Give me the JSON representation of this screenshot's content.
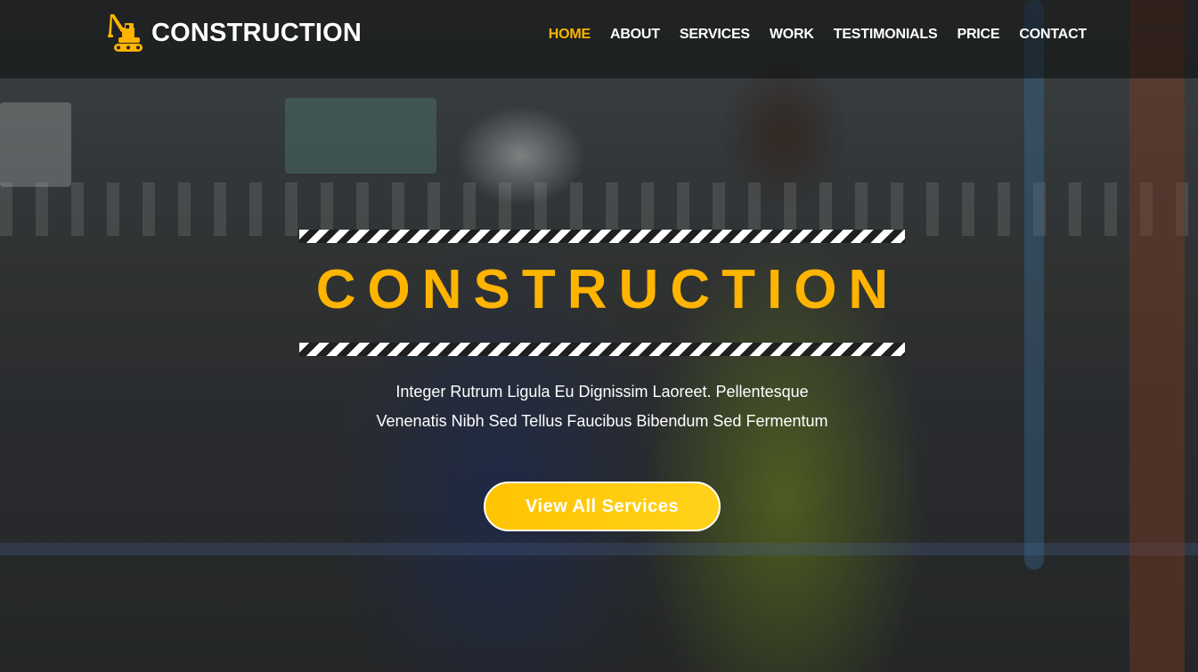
{
  "brand": {
    "name": "CONSTRUCTION",
    "icon": "crane-icon",
    "accent": "#ffb400"
  },
  "nav": {
    "items": [
      {
        "label": "HOME",
        "active": true
      },
      {
        "label": "ABOUT",
        "active": false
      },
      {
        "label": "SERVICES",
        "active": false
      },
      {
        "label": "WORK",
        "active": false
      },
      {
        "label": "TESTIMONIALS",
        "active": false
      },
      {
        "label": "PRICE",
        "active": false
      },
      {
        "label": "CONTACT",
        "active": false
      }
    ]
  },
  "hero": {
    "title": "CONSTRUCTION",
    "subtitle_line1": "Integer Rutrum Ligula Eu Dignissim Laoreet. Pellentesque",
    "subtitle_line2": "Venenatis Nibh Sed Tellus Faucibus Bibendum Sed Fermentum",
    "cta_label": "View All Services",
    "title_color": "#ffb400",
    "cta_color": "#ffc400"
  }
}
